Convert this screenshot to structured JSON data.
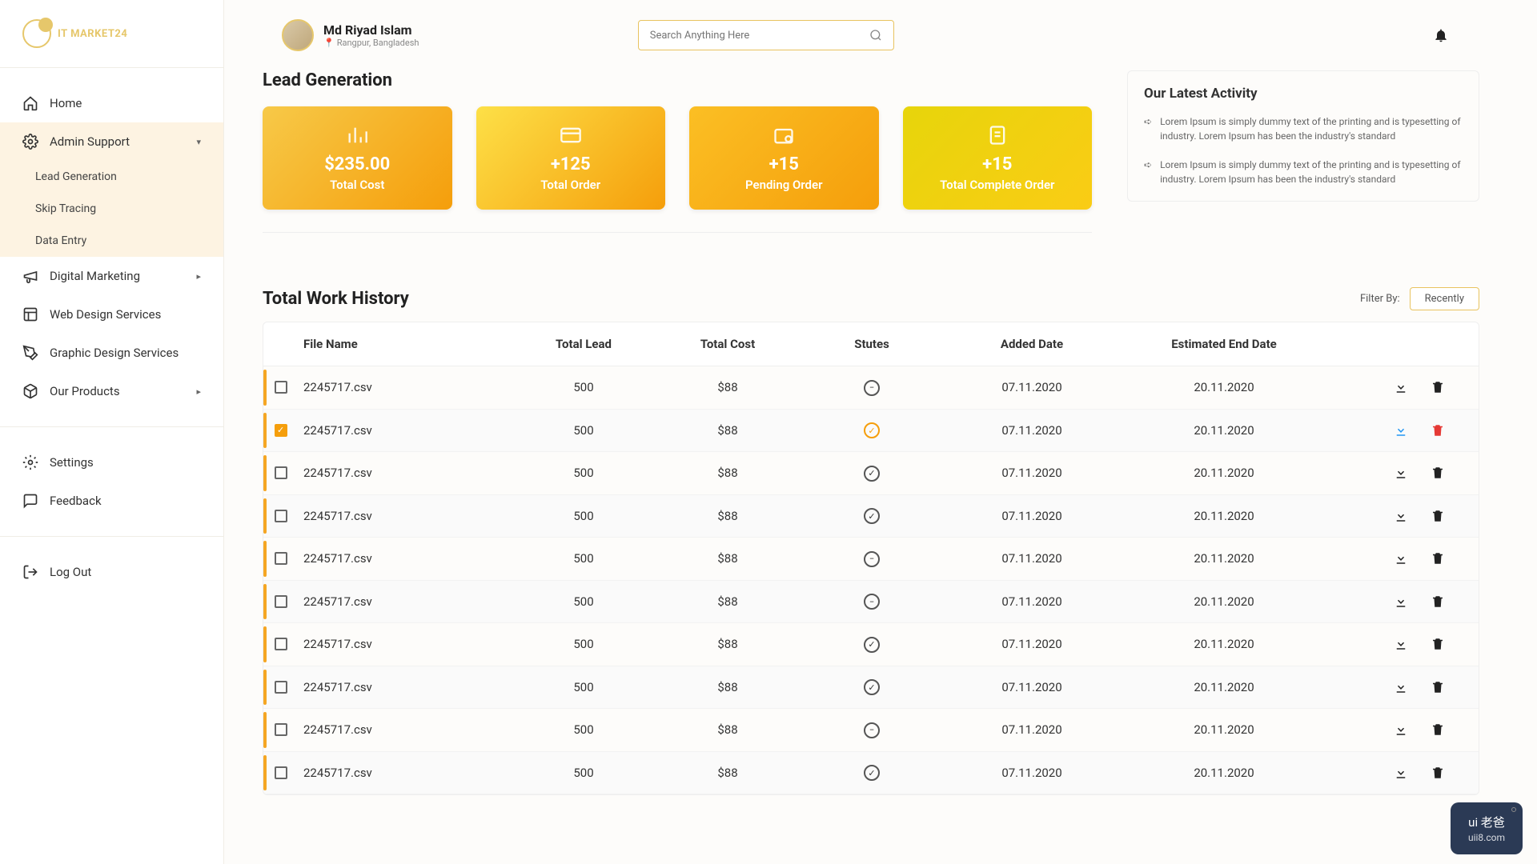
{
  "brand": {
    "name": "IT MARKET24"
  },
  "user": {
    "name": "Md Riyad Islam",
    "location": "Rangpur, Bangladesh"
  },
  "search": {
    "placeholder": "Search Anything Here"
  },
  "sidebar": {
    "home": "Home",
    "admin": "Admin Support",
    "admin_sub": {
      "lead": "Lead Generation",
      "skip": "Skip Tracing",
      "data": "Data Entry"
    },
    "digital": "Digital Marketing",
    "web": "Web Design Services",
    "graphic": "Graphic Design Services",
    "products": "Our Products",
    "settings": "Settings",
    "feedback": "Feedback",
    "logout": "Log Out"
  },
  "section": {
    "lead_gen": "Lead Generation",
    "history": "Total Work History"
  },
  "stats": {
    "cost": {
      "value": "$235.00",
      "label": "Total Cost"
    },
    "order": {
      "value": "+125",
      "label": "Total Order"
    },
    "pending": {
      "value": "+15",
      "label": "Pending Order"
    },
    "complete": {
      "value": "+15",
      "label": "Total Complete Order"
    }
  },
  "activity": {
    "title": "Our Latest Activity",
    "item1": "Lorem Ipsum is simply dummy text of the printing and is typesetting of industry. Lorem Ipsum has been the industry's standard",
    "item2": "Lorem Ipsum is simply dummy text of the printing and is typesetting of industry. Lorem Ipsum has been the industry's standard"
  },
  "filter": {
    "label": "Filter By:",
    "button": "Recently"
  },
  "table": {
    "headers": {
      "file": "File Name",
      "lead": "Total Lead",
      "cost": "Total Cost",
      "status": "Stutes",
      "added": "Added Date",
      "end": "Estimated End Date"
    },
    "rows": [
      {
        "file": "2245717.csv",
        "lead": "500",
        "cost": "$88",
        "status": "pending",
        "added": "07.11.2020",
        "end": "20.11.2020",
        "checked": false,
        "highlight": false
      },
      {
        "file": "2245717.csv",
        "lead": "500",
        "cost": "$88",
        "status": "done",
        "added": "07.11.2020",
        "end": "20.11.2020",
        "checked": true,
        "highlight": true
      },
      {
        "file": "2245717.csv",
        "lead": "500",
        "cost": "$88",
        "status": "done",
        "added": "07.11.2020",
        "end": "20.11.2020",
        "checked": false,
        "highlight": false
      },
      {
        "file": "2245717.csv",
        "lead": "500",
        "cost": "$88",
        "status": "done",
        "added": "07.11.2020",
        "end": "20.11.2020",
        "checked": false,
        "highlight": false
      },
      {
        "file": "2245717.csv",
        "lead": "500",
        "cost": "$88",
        "status": "pending",
        "added": "07.11.2020",
        "end": "20.11.2020",
        "checked": false,
        "highlight": false
      },
      {
        "file": "2245717.csv",
        "lead": "500",
        "cost": "$88",
        "status": "pending",
        "added": "07.11.2020",
        "end": "20.11.2020",
        "checked": false,
        "highlight": false
      },
      {
        "file": "2245717.csv",
        "lead": "500",
        "cost": "$88",
        "status": "done",
        "added": "07.11.2020",
        "end": "20.11.2020",
        "checked": false,
        "highlight": false
      },
      {
        "file": "2245717.csv",
        "lead": "500",
        "cost": "$88",
        "status": "done",
        "added": "07.11.2020",
        "end": "20.11.2020",
        "checked": false,
        "highlight": false
      },
      {
        "file": "2245717.csv",
        "lead": "500",
        "cost": "$88",
        "status": "pending",
        "added": "07.11.2020",
        "end": "20.11.2020",
        "checked": false,
        "highlight": false
      },
      {
        "file": "2245717.csv",
        "lead": "500",
        "cost": "$88",
        "status": "done",
        "added": "07.11.2020",
        "end": "20.11.2020",
        "checked": false,
        "highlight": false
      }
    ]
  },
  "watermark": {
    "top": "ui 老爸",
    "bottom": "uii8.com"
  }
}
